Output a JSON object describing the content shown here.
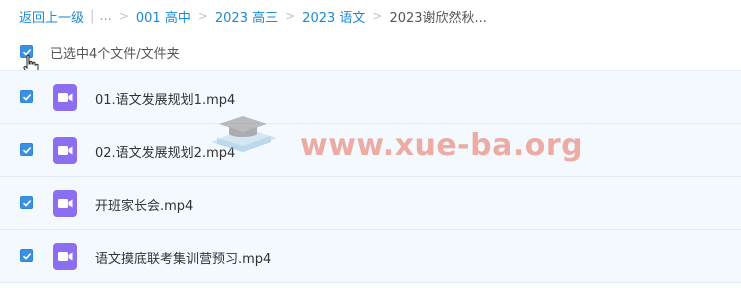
{
  "breadcrumb": {
    "back": "返回上一级",
    "ellipsis": "...",
    "items": [
      "001 高中",
      "2023 高三",
      "2023 语文"
    ],
    "current": "2023谢欣然秋..."
  },
  "selection": {
    "text": "已选中4个文件/文件夹",
    "checked": true
  },
  "files": [
    {
      "name": "01.语文发展规划1.mp4",
      "checked": true,
      "icon": "video-file-icon"
    },
    {
      "name": "02.语文发展规划2.mp4",
      "checked": true,
      "icon": "video-file-icon"
    },
    {
      "name": "开班家长会.mp4",
      "checked": true,
      "icon": "video-file-icon"
    },
    {
      "name": "语文摸底联考集训营预习.mp4",
      "checked": true,
      "icon": "video-file-icon"
    }
  ],
  "watermark": {
    "text": "www.xue-ba.org"
  },
  "colors": {
    "link": "#1b8ad7",
    "checkbox": "#3a91e2",
    "row_bg": "#f3f9fe",
    "video_icon": "#8c6ff0",
    "watermark": "#e66e5a"
  }
}
